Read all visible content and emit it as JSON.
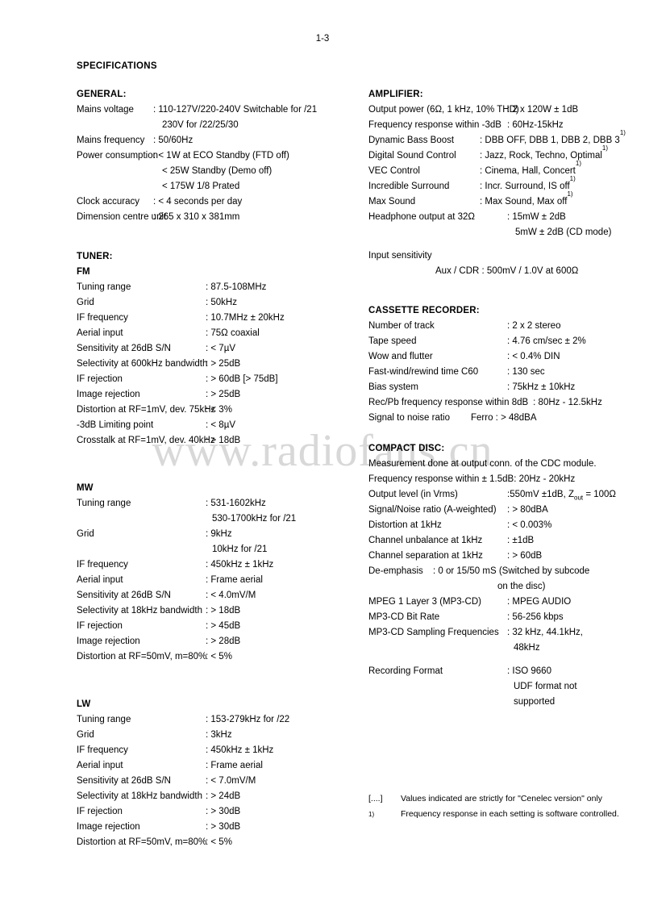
{
  "page": {
    "number": "1-3",
    "title": "SPECIFICATIONS",
    "watermark": "www.radiofans.cn"
  },
  "general": {
    "heading": "GENERAL:",
    "rows": [
      {
        "label": "Mains voltage",
        "value": ": 110-127V/220-240V Switchable for /21"
      },
      {
        "cont": "230V for /22/25/30"
      },
      {
        "label": "Mains frequency",
        "value": ": 50/60Hz"
      },
      {
        "label": "Power consumption",
        "value": ": < 1W at ECO Standby (FTD off)"
      },
      {
        "cont": "< 25W Standby (Demo off)"
      },
      {
        "cont": "< 175W 1/8 Prated"
      },
      {
        "label": "Clock accuracy",
        "value": ": < 4 seconds per day"
      },
      {
        "label": "Dimension centre unit",
        "value": ": 265 x 310 x 381mm"
      }
    ]
  },
  "tuner": {
    "heading": "TUNER:",
    "fm": {
      "heading": "FM",
      "rows": [
        {
          "label": "Tuning range",
          "value": ": 87.5-108MHz"
        },
        {
          "label": "Grid",
          "value": ": 50kHz"
        },
        {
          "label": "IF frequency",
          "value": ": 10.7MHz ± 20kHz"
        },
        {
          "label": "Aerial input",
          "value": ": 75Ω coaxial"
        },
        {
          "label": "Sensitivity at 26dB S/N",
          "value": ": < 7µV"
        },
        {
          "label": "Selectivity at 600kHz bandwidth",
          "value": ": > 25dB"
        },
        {
          "label": "IF rejection",
          "value": ": > 60dB [> 75dB]"
        },
        {
          "label": "Image rejection",
          "value": ": > 25dB"
        },
        {
          "label": "Distortion at RF=1mV, dev. 75kHz",
          "value": ": < 3%"
        },
        {
          "label": "-3dB Limiting point",
          "value": ": < 8µV"
        },
        {
          "label": "Crosstalk at RF=1mV, dev. 40kHz",
          "value": ": > 18dB"
        }
      ]
    },
    "mw": {
      "heading": "MW",
      "rows": [
        {
          "label": "Tuning range",
          "value": ": 531-1602kHz"
        },
        {
          "cont": "530-1700kHz for /21"
        },
        {
          "label": "Grid",
          "value": ": 9kHz"
        },
        {
          "cont": "10kHz for /21"
        },
        {
          "label": "IF frequency",
          "value": ": 450kHz ± 1kHz"
        },
        {
          "label": "Aerial input",
          "value": ": Frame aerial"
        },
        {
          "label": "Sensitivity at 26dB S/N",
          "value": ": < 4.0mV/M"
        },
        {
          "label": "Selectivity at 18kHz bandwidth",
          "value": ": > 18dB"
        },
        {
          "label": "IF rejection",
          "value": ": > 45dB"
        },
        {
          "label": "Image rejection",
          "value": ": > 28dB"
        },
        {
          "label": "Distortion at RF=50mV, m=80%",
          "value": ": < 5%"
        }
      ]
    },
    "lw": {
      "heading": "LW",
      "rows": [
        {
          "label": "Tuning range",
          "value": ": 153-279kHz for /22"
        },
        {
          "label": "Grid",
          "value": ": 3kHz"
        },
        {
          "label": "IF frequency",
          "value": ": 450kHz ± 1kHz"
        },
        {
          "label": "Aerial input",
          "value": ": Frame aerial"
        },
        {
          "label": "Sensitivity at 26dB S/N",
          "value": ": < 7.0mV/M"
        },
        {
          "label": "Selectivity at 18kHz bandwidth",
          "value": ": > 24dB"
        },
        {
          "label": "IF rejection",
          "value": ": > 30dB"
        },
        {
          "label": "Image rejection",
          "value": ": > 30dB"
        },
        {
          "label": "Distortion at RF=50mV, m=80%",
          "value": ": < 5%"
        }
      ]
    }
  },
  "amplifier": {
    "heading": "AMPLIFIER:",
    "rows_wide": [
      {
        "label": "Output power (6Ω, 1 kHz, 10% THD)",
        "value": ": 2 x 120W ± 1dB"
      },
      {
        "label": "Frequency response within -3dB",
        "value": ": 60Hz-15kHz"
      }
    ],
    "rows_narrow": [
      {
        "label": "Dynamic Bass Boost",
        "value": ": DBB OFF, DBB 1, DBB 2, DBB 3",
        "sup": "1)"
      },
      {
        "label": "Digital Sound Control",
        "value": ": Jazz, Rock, Techno, Optimal",
        "sup": "1)"
      },
      {
        "label": "VEC Control",
        "value": ": Cinema, Hall, Concert",
        "sup": "1)"
      },
      {
        "label": "Incredible Surround",
        "value": ": Incr. Surround, IS off",
        "sup": "1)"
      },
      {
        "label": "Max Sound",
        "value": ": Max Sound, Max off",
        "sup": "1)"
      }
    ],
    "headphone": {
      "label": "Headphone output at 32Ω",
      "value": ": 15mW ± 2dB"
    },
    "headphone_cont": "5mW ± 2dB (CD mode)",
    "input_sensitivity_label": "Input sensitivity",
    "input_sensitivity_value": "Aux / CDR  : 500mV / 1.0V at 600Ω"
  },
  "cassette": {
    "heading": "CASSETTE RECORDER:",
    "rows": [
      {
        "label": "Number of track",
        "value": ": 2 x 2 stereo"
      },
      {
        "label": "Tape speed",
        "value": ": 4.76 cm/sec ± 2%"
      },
      {
        "label": "Wow and flutter",
        "value": ": < 0.4% DIN"
      },
      {
        "label": "Fast-wind/rewind time C60",
        "value": ": 130 sec"
      },
      {
        "label": "Bias system",
        "value": ": 75kHz ± 10kHz"
      },
      {
        "label": "Rec/Pb frequency response within 8dB",
        "value": ": 80Hz - 12.5kHz",
        "wide": true
      },
      {
        "label": "Signal to noise ratio",
        "value": "Ferro  : > 48dBA",
        "ferro": true
      }
    ]
  },
  "compact_disc": {
    "heading": "COMPACT DISC:",
    "note": "Measurement done at output conn. of the CDC module.",
    "freq_response": {
      "label": "Frequency response within ± 1.5dB",
      "value": ": 20Hz - 20kHz"
    },
    "output_level": {
      "label": "Output level (in Vrms)",
      "value_pre": ":550mV ±1dB, Z",
      "sub": "out",
      "value_post": " = 100Ω"
    },
    "rows": [
      {
        "label": "Signal/Noise ratio (A-weighted)",
        "value": ": > 80dBA"
      },
      {
        "label": "Distortion at 1kHz",
        "value": ": < 0.003%"
      },
      {
        "label": "Channel unbalance at 1kHz",
        "value": ": ±1dB"
      },
      {
        "label": "Channel separation at 1kHz",
        "value": ": > 60dB"
      }
    ],
    "deemphasis": {
      "label": "De-emphasis",
      "value": ": 0 or 15/50 mS (Switched by subcode"
    },
    "deemphasis_cont": "on the disc)",
    "rows2": [
      {
        "label": "MPEG 1 Layer 3 (MP3-CD)",
        "value": ": MPEG AUDIO"
      },
      {
        "label": "MP3-CD Bit Rate",
        "value": ": 56-256 kbps"
      },
      {
        "label": "MP3-CD Sampling Frequencies",
        "value": ": 32 kHz, 44.1kHz,"
      }
    ],
    "sampling_cont": "48kHz",
    "recording_format": {
      "label": "Recording Format",
      "value": ": ISO 9660"
    },
    "recording_cont1": "UDF format not",
    "recording_cont2": "supported"
  },
  "footnotes": [
    {
      "mark": "[....]",
      "text": "Values indicated are strictly for \"Cenelec version\" only",
      "sup": false
    },
    {
      "mark": "1)",
      "text": "Frequency response in each setting is software controlled.",
      "sup": true
    }
  ]
}
